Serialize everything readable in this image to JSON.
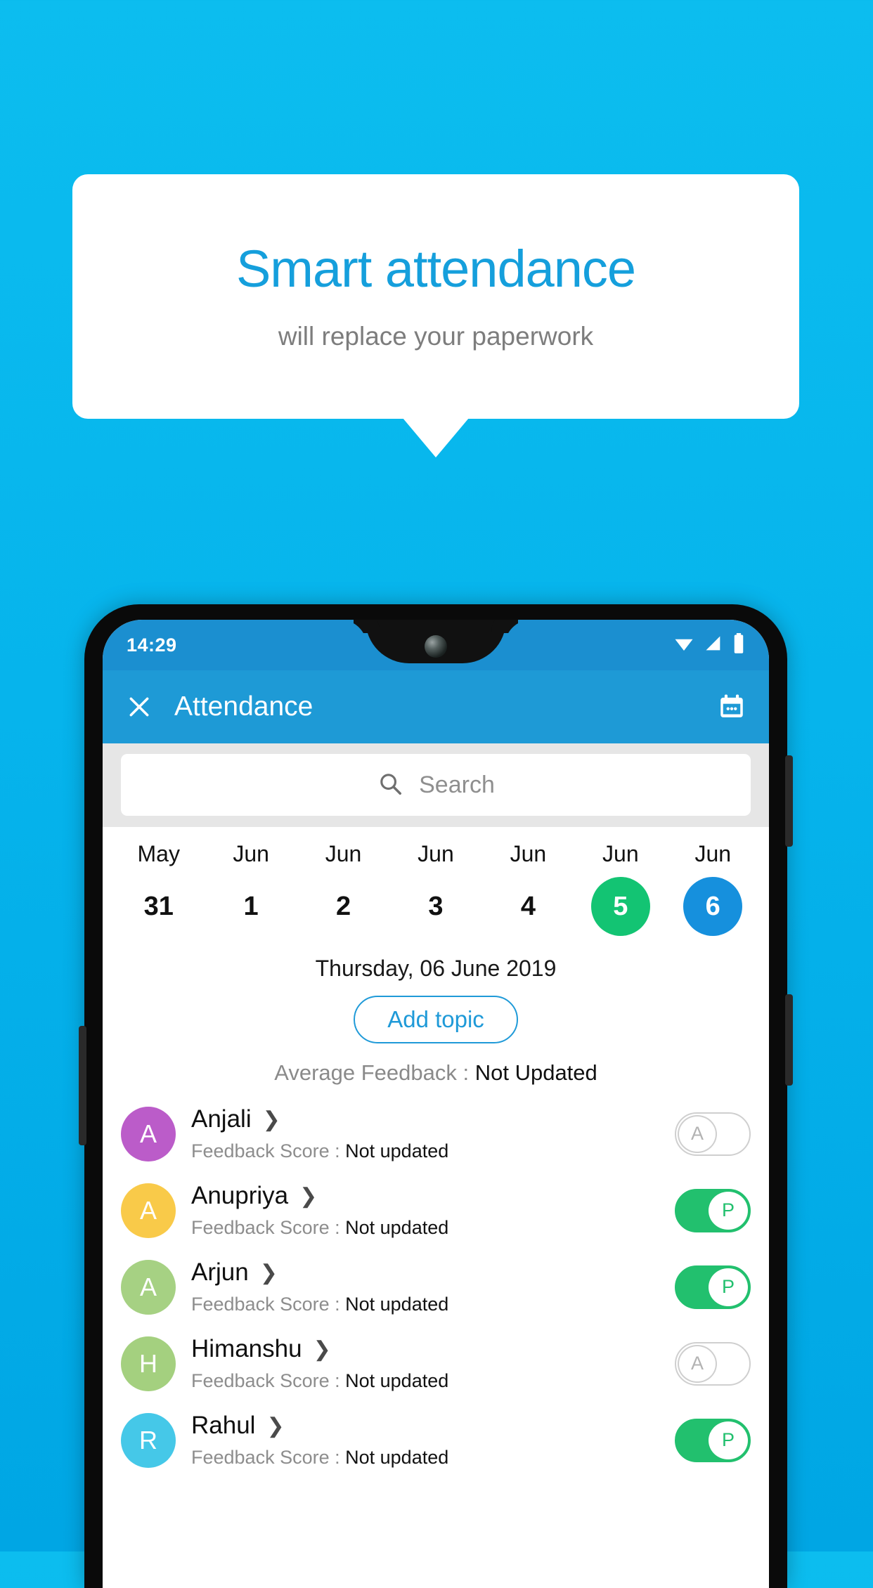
{
  "promo": {
    "title": "Smart attendance",
    "subtitle": "will replace your paperwork"
  },
  "colors": {
    "background_top": "#0cbdef",
    "background_bottom": "#00a6e4",
    "brand_blue": "#1e9ad6",
    "title_blue": "#159fdc",
    "present_green": "#22c06e",
    "date_selected_green": "#13c473",
    "date_selected_blue": "#1690dd"
  },
  "phone": {
    "status_bar": {
      "time": "14:29",
      "icons": [
        "wifi-icon",
        "signal-icon",
        "battery-icon"
      ]
    },
    "app_bar": {
      "close_icon": "close-icon",
      "title": "Attendance",
      "calendar_icon": "calendar-icon"
    },
    "search": {
      "icon": "search-icon",
      "placeholder": "Search",
      "value": ""
    },
    "date_strip": [
      {
        "month": "May",
        "day": "31",
        "state": "normal"
      },
      {
        "month": "Jun",
        "day": "1",
        "state": "normal"
      },
      {
        "month": "Jun",
        "day": "2",
        "state": "normal"
      },
      {
        "month": "Jun",
        "day": "3",
        "state": "normal"
      },
      {
        "month": "Jun",
        "day": "4",
        "state": "normal"
      },
      {
        "month": "Jun",
        "day": "5",
        "state": "green"
      },
      {
        "month": "Jun",
        "day": "6",
        "state": "blue"
      }
    ],
    "selected_date_label": "Thursday, 06 June 2019",
    "add_topic_label": "Add topic",
    "average_feedback": {
      "label": "Average Feedback : ",
      "value": "Not Updated"
    },
    "feedback_score_label": "Feedback Score : ",
    "students": [
      {
        "name": "Anjali",
        "initial": "A",
        "avatar_color": "#bb5cc9",
        "feedback": "Not updated",
        "attendance": "A",
        "present": false
      },
      {
        "name": "Anupriya",
        "initial": "A",
        "avatar_color": "#f9ca49",
        "feedback": "Not updated",
        "attendance": "P",
        "present": true
      },
      {
        "name": "Arjun",
        "initial": "A",
        "avatar_color": "#a6d183",
        "feedback": "Not updated",
        "attendance": "P",
        "present": true
      },
      {
        "name": "Himanshu",
        "initial": "H",
        "avatar_color": "#a4d07f",
        "feedback": "Not updated",
        "attendance": "A",
        "present": false
      },
      {
        "name": "Rahul",
        "initial": "R",
        "avatar_color": "#45c8e8",
        "feedback": "Not updated",
        "attendance": "P",
        "present": true
      }
    ],
    "row_chevron": "chevron-right-icon"
  }
}
